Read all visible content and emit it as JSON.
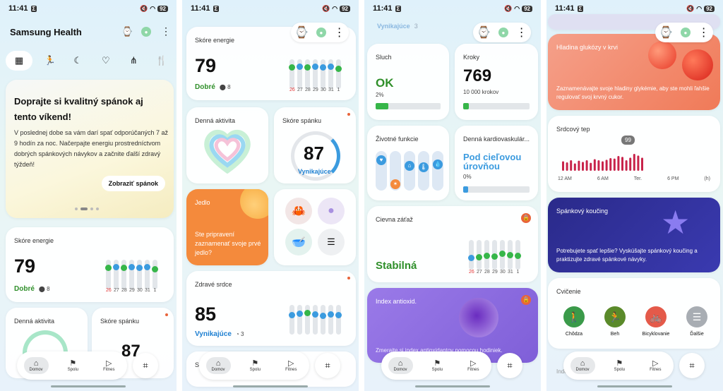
{
  "status": {
    "time": "11:41",
    "notif_badge": "Σ",
    "battery": "92"
  },
  "header_icons": {
    "watch": "watch-icon",
    "more": "more-icon"
  },
  "s1": {
    "app_title": "Samsung Health",
    "tabs": [
      "grid-icon",
      "running-icon",
      "moon-icon",
      "heart-icon",
      "nodes-icon",
      "food-icon"
    ],
    "banner": {
      "title": "Doprajte si kvalitný spánok aj tento víkend!",
      "body": "V poslednej dobe sa vám darí spať odporúčaných 7 až 9 hodín za noc. Načerpajte energiu prostredníctvom dobrých spánkových návykov a začnite ďalší zdravý týždeň!",
      "button": "Zobraziť spánok"
    },
    "energy": {
      "title": "Skóre energie",
      "value": "79",
      "status": "Dobré",
      "sub": "8"
    },
    "activity_title": "Denná aktivita",
    "sleep": {
      "title": "Skóre spánku",
      "value": "87"
    }
  },
  "energy_days": [
    "26",
    "27",
    "28",
    "29",
    "30",
    "31",
    "1"
  ],
  "energy_levels": [
    0.78,
    0.82,
    0.78,
    0.82,
    0.78,
    0.82,
    0.72
  ],
  "energy_dot_colors": [
    "g",
    "b",
    "g",
    "b",
    "b",
    "b",
    "g"
  ],
  "s2": {
    "energy": {
      "title": "Skóre energie",
      "value": "79",
      "status": "Dobré",
      "sub": "8"
    },
    "activity_title": "Denná aktivita",
    "sleep": {
      "title": "Skóre spánku",
      "value": "87",
      "status": "Vynikajúce"
    },
    "food": {
      "title": "Jedlo",
      "body": "Ste pripravení zaznamenať svoje prvé jedlo?"
    },
    "heart": {
      "title": "Zdravé srdce",
      "value": "85",
      "status": "Vynikajúce",
      "sub": "3"
    },
    "peek": "Sl"
  },
  "s3": {
    "top_status": "Vynikajúce",
    "top_sub": "3",
    "hearing": {
      "title": "Sluch",
      "value": "OK",
      "sub": "2%",
      "progress": 0.2
    },
    "steps": {
      "title": "Kroky",
      "value": "769",
      "sub": "10 000 krokov",
      "progress": 0.08
    },
    "vitals_title": "Životné funkcie",
    "cardio": {
      "title": "Denná kardiovaskulár...",
      "value": "Pod cieľovou úrovňou",
      "sub": "0%",
      "progress": 0.07
    },
    "vascular": {
      "title": "Cievna záťaž",
      "value": "Stabilná"
    },
    "antiox": {
      "title": "Index antioxid.",
      "body": "Zmerajte si index antioxidantov pomocou hodiniek."
    }
  },
  "vascular_days": [
    "26",
    "27",
    "28",
    "29",
    "30",
    "31",
    "1"
  ],
  "vascular_levels": [
    0.35,
    0.4,
    0.45,
    0.42,
    0.55,
    0.5,
    0.45
  ],
  "s4": {
    "glucose": {
      "title": "Hladina glukózy v krvi",
      "body": "Zaznamenávajte svoje hladiny glykémie, aby ste mohli ľahšie regulovať svoj krvný cukor."
    },
    "hr": {
      "title": "Srdcový tep",
      "bubble": "99",
      "labels": [
        "12 AM",
        "6 AM",
        "Ter.",
        "6 PM",
        "(h)"
      ]
    },
    "coach": {
      "title": "Spánkový koučing",
      "body": "Potrebujete spať lepšie? Vyskúšajte spánkový koučing a praktizujte zdravé spánkové návyky."
    },
    "exercise": {
      "title": "Cvičenie",
      "items": [
        {
          "label": "Chôdza",
          "icon": "walk-icon",
          "color": "#3a9a4a"
        },
        {
          "label": "Beh",
          "icon": "run-icon",
          "color": "#5a8a2a"
        },
        {
          "label": "Bicyklovanie",
          "icon": "bike-icon",
          "color": "#e45a4a"
        },
        {
          "label": "Ďalšie",
          "icon": "list-icon",
          "color": "#a8adb3"
        }
      ]
    },
    "peek": "Inde"
  },
  "hr_values": [
    0.45,
    0.4,
    0.5,
    0.35,
    0.48,
    0.42,
    0.5,
    0.38,
    0.55,
    0.5,
    0.45,
    0.52,
    0.6,
    0.58,
    0.7,
    0.66,
    0.5,
    0.62,
    0.8,
    0.72,
    0.62
  ],
  "nav": {
    "home": "Domov",
    "together": "Spolu",
    "fitness": "Fitnes"
  }
}
